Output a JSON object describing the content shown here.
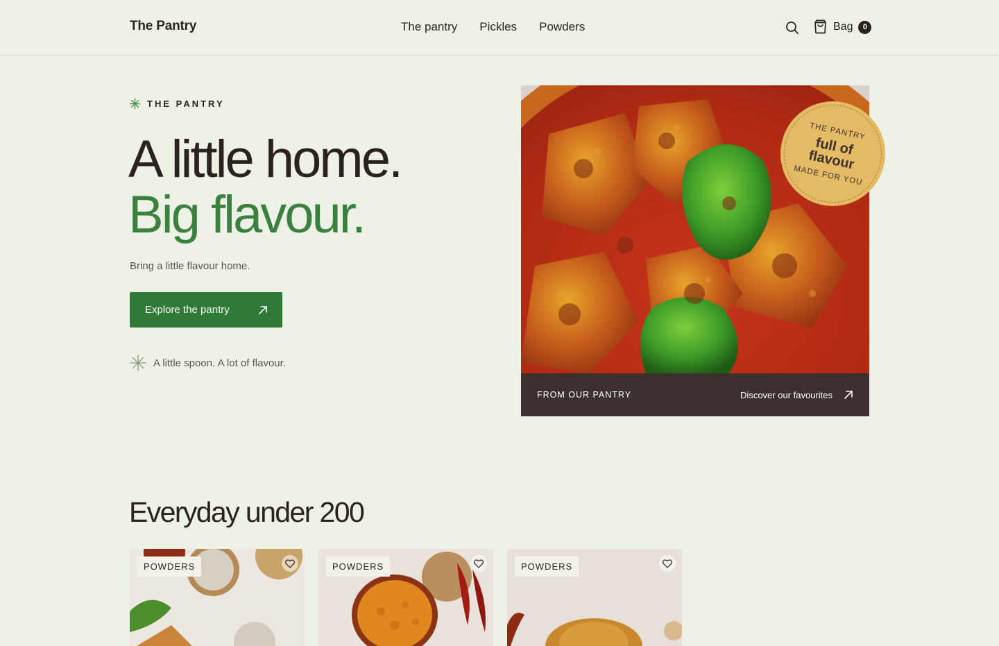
{
  "header": {
    "brand": "The Pantry",
    "nav": [
      "The pantry",
      "Pickles",
      "Powders"
    ],
    "bag_label": "Bag",
    "bag_count": "0",
    "icons": {
      "search": "search-icon",
      "bag": "shopping-bag-icon"
    }
  },
  "hero": {
    "eyebrow": "THE PANTRY",
    "headline_line1": "A little home.",
    "headline_line2": "Big flavour.",
    "subcopy": "Bring a little flavour home.",
    "cta_label": "Explore the pantry",
    "tagline": "A little spoon. A lot of flavour."
  },
  "hero_card": {
    "footer_left": "FROM OUR PANTRY",
    "footer_link": "Discover our favourites",
    "badge": {
      "top": "THE PANTRY",
      "main": "full of flavour",
      "bottom": "MADE FOR YOU"
    }
  },
  "section": {
    "title": "Everyday under 200",
    "products": [
      {
        "tag": "POWDERS"
      },
      {
        "tag": "POWDERS"
      },
      {
        "tag": "POWDERS"
      }
    ]
  },
  "colors": {
    "background": "#eef2e6",
    "accent_green": "#2f7a36",
    "headline_green": "#3a803f",
    "ink": "#2b2220",
    "badge_gold": "#e4bb64",
    "card_footer": "#3b302d"
  }
}
